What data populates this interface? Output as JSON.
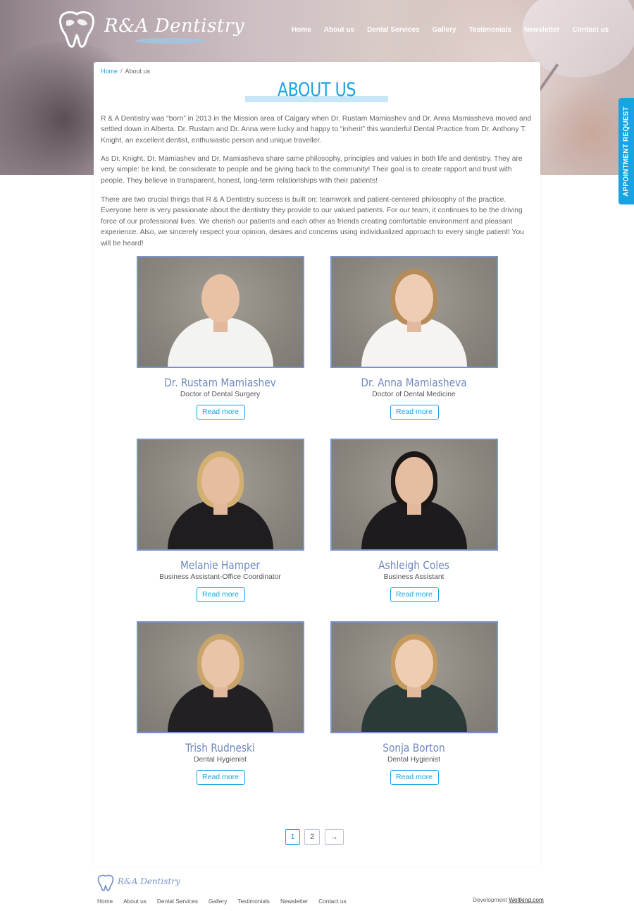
{
  "brand": {
    "name": "R&A Dentistry"
  },
  "nav": {
    "items": [
      "Home",
      "About us",
      "Dental Services",
      "Gallery",
      "Testimonials",
      "Newsletter",
      "Contact us"
    ]
  },
  "side_tab": {
    "label": "APPOINTMENT REQUEST"
  },
  "breadcrumb": {
    "home": "Home",
    "separator": "/",
    "current": "About us"
  },
  "page": {
    "title": "ABOUT US",
    "paragraphs": [
      "R & A Dentistry was “born” in 2013 in the Mission area of Calgary when Dr. Rustam Mamiashev and Dr. Anna Mamiasheva moved and settled down in Alberta. Dr. Rustam and Dr. Anna were lucky and happy to “inherit” this wonderful Dental Practice from Dr. Anthony T. Knight, an excellent dentist, enthusiastic person and unique traveller.",
      "As Dr. Knight,  Dr. Mamiashev and Dr. Mamiasheva share same philosophy, principles and values in both life and dentistry. They are very simple: be kind, be considerate to people and be giving back to the community! Their goal is to create rapport and trust with people. They believe in transparent, honest, long-term relationships with their patients!",
      "There are two crucial things that R & A Dentistry success is built on: teamwork and patient-centered philosophy of the practice. Everyone here is very passionate about the dentistry they provide to our valued patients. For our team, it continues to be the driving force of our professional lives.  We cherish our patients and each other as friends creating comfortable environment and pleasant experience. Also, we sincerely respect your opinion, desires and concerns using individualized approach to every single patient! You will be heard!"
    ]
  },
  "staff": [
    {
      "name": "Dr. Rustam Mamiashev",
      "role": "Doctor of Dental Surgery",
      "button": "Read more"
    },
    {
      "name": "Dr. Anna Mamiasheva",
      "role": "Doctor of Dental Medicine",
      "button": "Read more"
    },
    {
      "name": "Melanie Hamper",
      "role": "Business Assistant-Office Coordinator",
      "button": "Read more"
    },
    {
      "name": "Ashleigh Coles",
      "role": "Business Assistant",
      "button": "Read more"
    },
    {
      "name": "Trish Rudneski",
      "role": "Dental Hygienist",
      "button": "Read more"
    },
    {
      "name": "Sonja Borton",
      "role": "Dental Hygienist",
      "button": "Read more"
    }
  ],
  "pagination": {
    "pages": [
      "1",
      "2"
    ],
    "next": "→",
    "current": "1"
  },
  "footer": {
    "nav": [
      "Home",
      "About us",
      "Dental Services",
      "Gallery",
      "Testimonials",
      "Newsletter",
      "Contact us"
    ],
    "dev_prefix": "Development",
    "dev_link": "Weltkind.com"
  },
  "colors": {
    "accent": "#1aa3e2",
    "name_blue": "#6f89bf",
    "photo_border": "#7b95cc"
  }
}
